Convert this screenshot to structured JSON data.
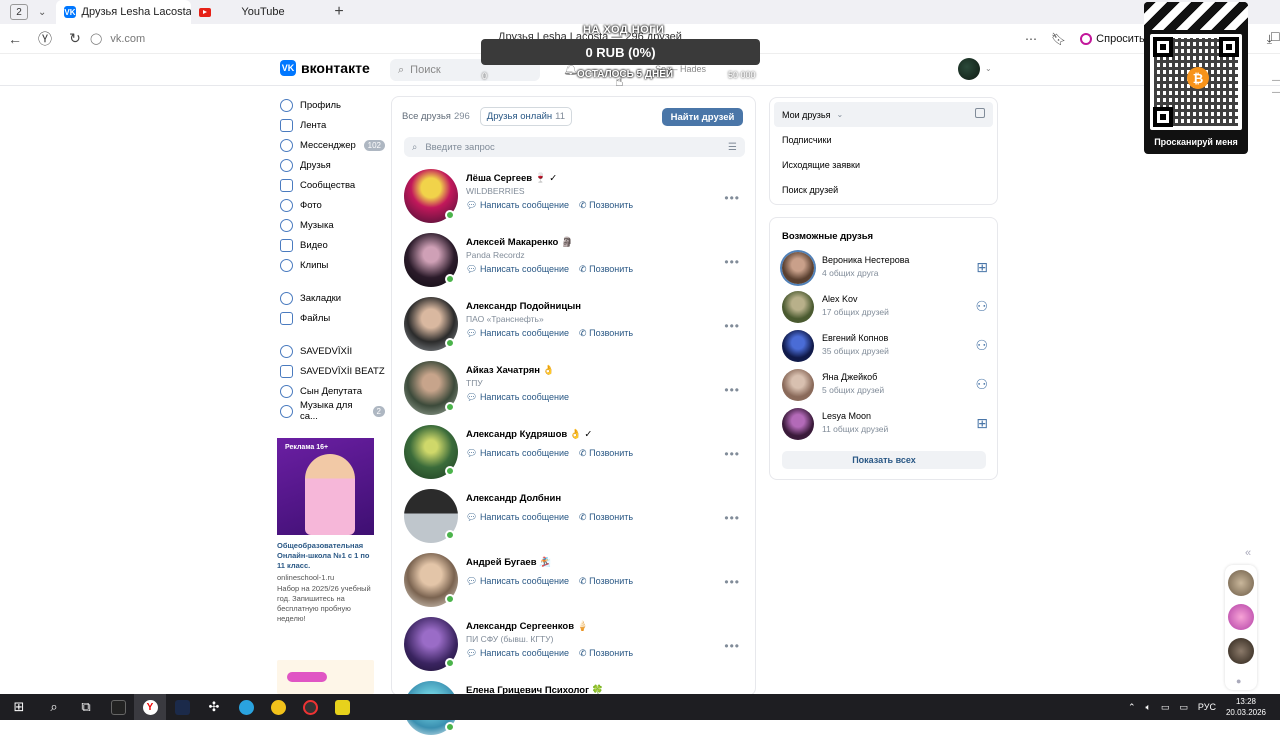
{
  "browser": {
    "tab_count": "2",
    "tabs": [
      {
        "label": "Друзья Lesha Lacosta"
      },
      {
        "label": "YouTube"
      }
    ],
    "url": "vk.com",
    "page_title": "Друзья Lesha Lacosta — 296 друзей",
    "alice_label": "Спросить Алису"
  },
  "vk_header": {
    "logo_text": "вконтакте",
    "search_placeholder": "Поиск",
    "music_text": "So — Hades"
  },
  "overlay": {
    "top_text": "НА ХОД НОГИ",
    "amount": "0 RUB (0%)",
    "bottom_text": "ОСТАЛОСЬ 5 ДНЕЙ",
    "min": "0",
    "max": "50 000",
    "progress_fraction": 0.0
  },
  "left_nav": {
    "items": [
      {
        "label": "Профиль"
      },
      {
        "label": "Лента"
      },
      {
        "label": "Мессенджер",
        "badge": "102"
      },
      {
        "label": "Друзья"
      },
      {
        "label": "Сообщества"
      },
      {
        "label": "Фото"
      },
      {
        "label": "Музыка"
      },
      {
        "label": "Видео"
      },
      {
        "label": "Клипы"
      }
    ],
    "items2": [
      {
        "label": "Закладки"
      },
      {
        "label": "Файлы"
      }
    ],
    "items3": [
      {
        "label": "SAVEDVÏXİI"
      },
      {
        "label": "SAVEDVÏXİI BEATZ"
      },
      {
        "label": "Сын Депутата"
      },
      {
        "label": "Музыка для са...",
        "badge": "2"
      }
    ]
  },
  "ad": {
    "tag": "Реклама 16+",
    "title": "Общеобразовательная Онлайн-школа №1 с 1 по 11 класс.",
    "url": "onlineschool-1.ru",
    "desc": "Набор на 2025/26 учебный год. Запишитесь на бесплатную пробную неделю!"
  },
  "friends": {
    "tab_all": "Все друзья",
    "tab_all_count": "296",
    "tab_online": "Друзья онлайн",
    "tab_online_count": "11",
    "find_button": "Найти друзей",
    "search_placeholder": "Введите запрос",
    "write_label": "Написать сообщение",
    "call_label": "Позвонить",
    "list": [
      {
        "name": "Лёша Сергеев 🍷 ✓",
        "sub": "WILDBERRIES",
        "call": true
      },
      {
        "name": "Алексей Макаренко 🗿",
        "sub": "Panda Recordz",
        "call": true
      },
      {
        "name": "Александр Подойницын",
        "sub": "ПАО «Транснефть»",
        "call": true
      },
      {
        "name": "Айказ Хачатрян 👌",
        "sub": "ТПУ",
        "call": false
      },
      {
        "name": "Александр Кудряшов 👌 ✓",
        "sub": "",
        "call": true
      },
      {
        "name": "Александр Долбнин",
        "sub": "",
        "call": true
      },
      {
        "name": "Андрей Бугаев 🏂",
        "sub": "",
        "call": true
      },
      {
        "name": "Александр Сергеенков 🍦",
        "sub": "ПИ СФУ (бывш. КГТУ)",
        "call": true
      },
      {
        "name": "Елена Грицевич Психолог 🍀",
        "sub": "",
        "call": false
      }
    ]
  },
  "right_menu": {
    "items": [
      "Мои друзья",
      "Подписчики",
      "Исходящие заявки",
      "Поиск друзей"
    ]
  },
  "possible": {
    "title": "Возможные друзья",
    "people": [
      {
        "name": "Вероника Нестерова",
        "mutual": "4 общих друга"
      },
      {
        "name": "Alex Kov",
        "mutual": "17 общих друзей"
      },
      {
        "name": "Евгений Копнов",
        "mutual": "35 общих друзей"
      },
      {
        "name": "Яна Джейкоб",
        "mutual": "5 общих друзей"
      },
      {
        "name": "Lesya Moon",
        "mutual": "11 общих друзей"
      }
    ],
    "show_all": "Показать всех"
  },
  "qr_widget": {
    "caption": "Просканируй меня",
    "coin_symbol": "₿"
  },
  "taskbar": {
    "lang": "РУС",
    "time": "13:28",
    "date": "20.03.2026"
  }
}
